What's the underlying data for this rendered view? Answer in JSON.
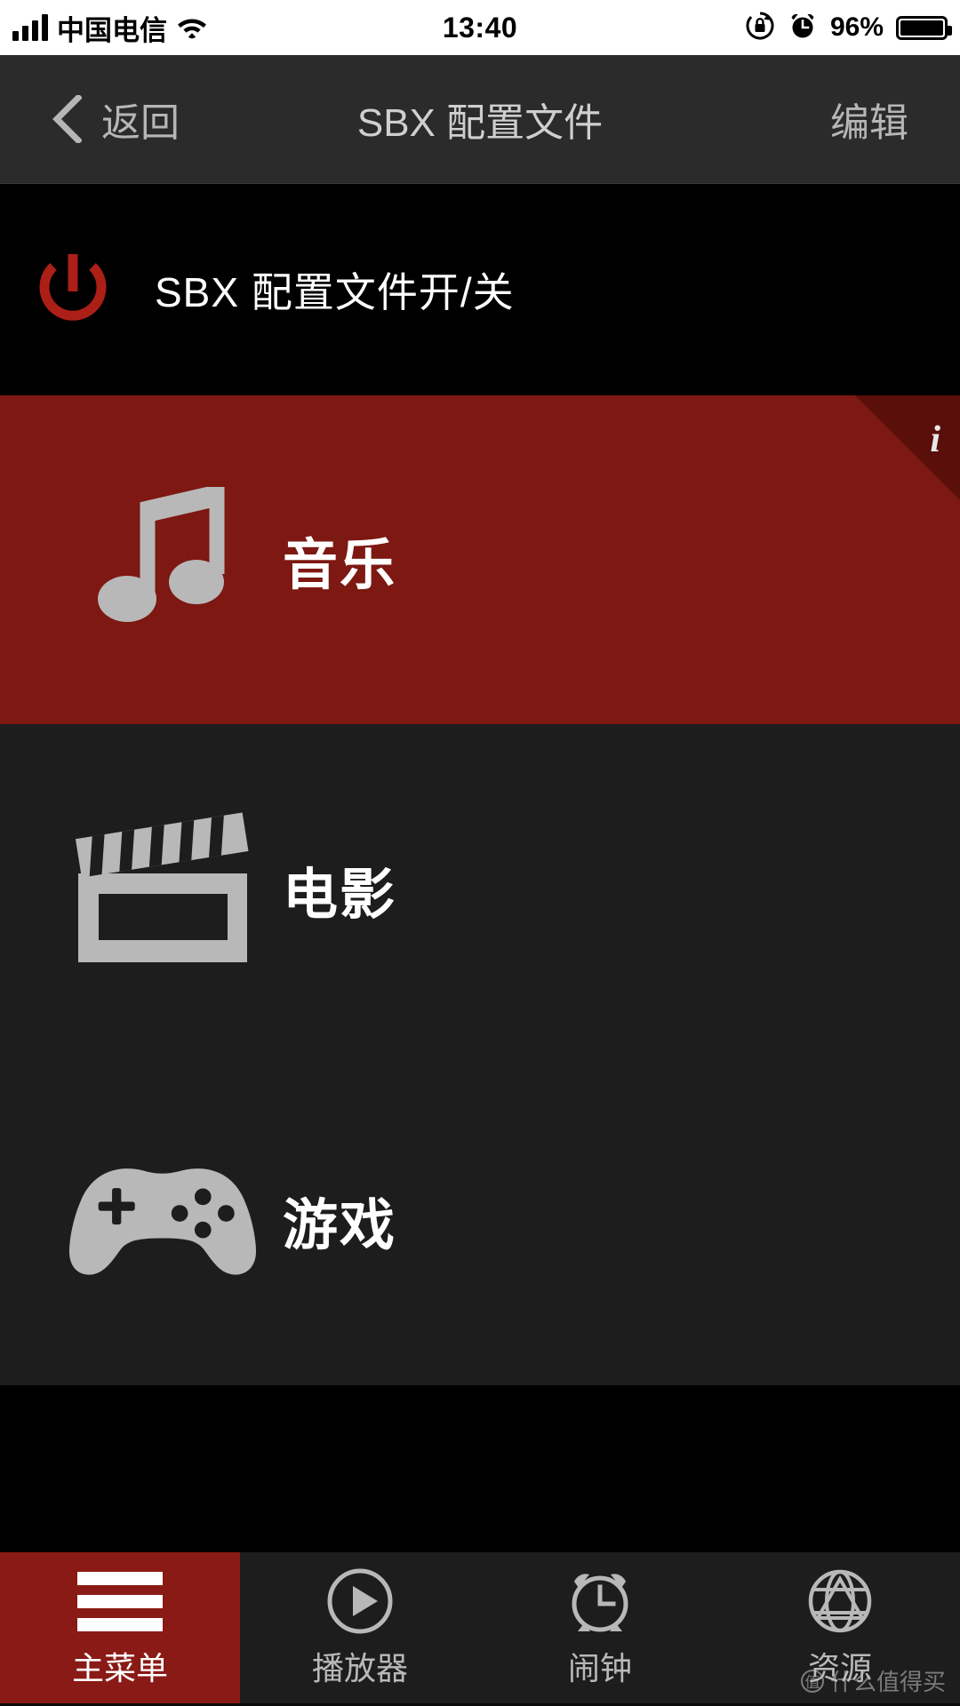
{
  "status_bar": {
    "signal_icon": "signal-bars-icon",
    "carrier": "中国电信",
    "wifi_icon": "wifi-icon",
    "time": "13:40",
    "rotation_lock_icon": "rotation-lock-icon",
    "alarm_icon": "alarm-clock-icon",
    "battery_percent": "96%",
    "battery_icon": "battery-full-icon"
  },
  "nav_bar": {
    "back_icon": "chevron-left-icon",
    "back_label": "返回",
    "title": "SBX 配置文件",
    "edit_label": "编辑"
  },
  "power_row": {
    "icon": "power-icon",
    "label": "SBX 配置文件开/关",
    "icon_color": "#ac1f17"
  },
  "categories": [
    {
      "icon": "music-note-icon",
      "label": "音乐",
      "active": true,
      "bg": "#7d1812",
      "info_badge": "i"
    },
    {
      "icon": "clapperboard-icon",
      "label": "电影",
      "active": false,
      "bg": "#1d1d1d"
    },
    {
      "icon": "gamepad-icon",
      "label": "游戏",
      "active": false,
      "bg": "#1d1d1d"
    }
  ],
  "tab_bar": {
    "active_color": "#8a1a15",
    "tabs": [
      {
        "icon": "hamburger-menu-icon",
        "label": "主菜单",
        "active": true
      },
      {
        "icon": "play-circle-icon",
        "label": "播放器",
        "active": false
      },
      {
        "icon": "alarm-clock-icon",
        "label": "闹钟",
        "active": false
      },
      {
        "icon": "globe-icon",
        "label": "资源",
        "active": false
      }
    ]
  },
  "watermark": {
    "text": "什么值得买"
  }
}
